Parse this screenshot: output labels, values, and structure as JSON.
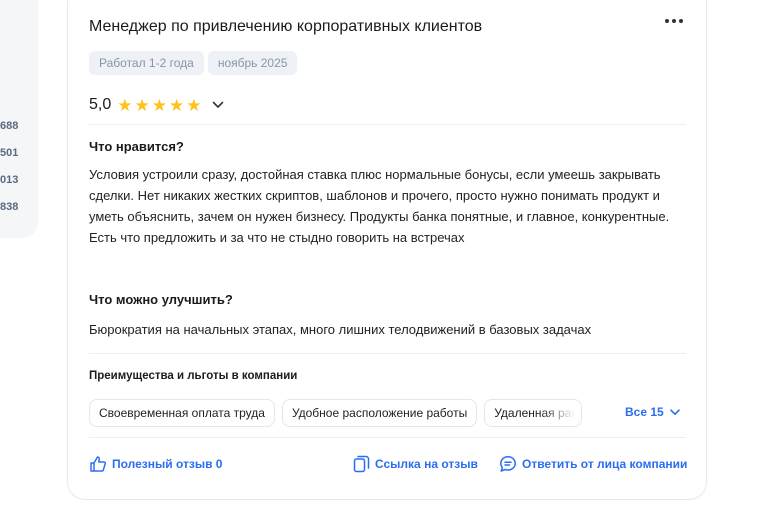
{
  "side_numbers": [
    "688",
    "501",
    "013",
    "838"
  ],
  "review": {
    "title": "Менеджер по привлечению корпоративных клиентов",
    "tags": [
      "Работал 1-2 года",
      "ноябрь 2025"
    ],
    "rating": "5,0",
    "rating_stars": 5,
    "likes_heading": "Что нравится?",
    "likes_text": "Условия устроили сразу, достойная ставка плюс нормальные бонусы, если умеешь закрывать сделки. Нет никаких жестких скриптов, шаблонов и прочего, просто нужно понимать продукт и уметь объяснить, зачем он нужен бизнесу. Продукты банка понятные, и главное, конкурентные. Есть что предложить и за что не стыдно говорить на встречах",
    "improve_heading": "Что можно улучшить?",
    "improve_text": "Бюрократия на начальных этапах, много лишних телодвижений в базовых задачах"
  },
  "benefits": {
    "title": "Преимущества и льготы в компании",
    "chips": [
      "Своевременная оплата труда",
      "Удобное расположение работы",
      "Удаленная работа"
    ],
    "all_label": "Все 15"
  },
  "actions": {
    "helpful": "Полезный отзыв 0",
    "link": "Ссылка на отзыв",
    "reply": "Ответить от лица компании"
  },
  "colors": {
    "accent": "#2b6df2",
    "star": "#ffc21a",
    "tag_bg": "#eef1f5"
  },
  "icons": [
    "more-icon",
    "star-icon",
    "chevron-down-icon",
    "thumbs-up-icon",
    "copy-link-icon",
    "chat-icon"
  ]
}
